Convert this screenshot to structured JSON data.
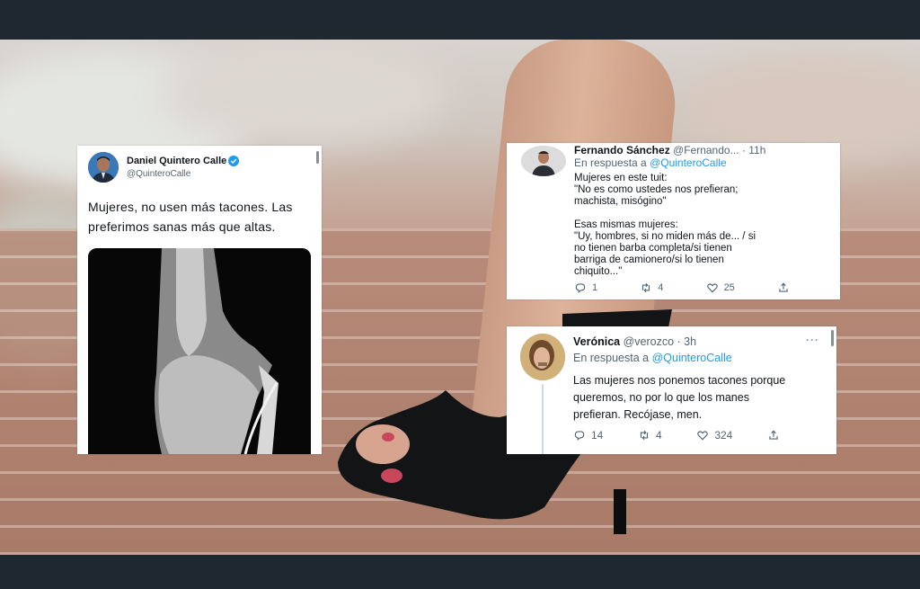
{
  "tweet_main": {
    "name": "Daniel Quintero Calle",
    "handle": "@QuinteroCalle",
    "text": "Mujeres, no usen más tacones. Las\npreferimos sanas más que altas."
  },
  "tweet_fernando": {
    "name": "Fernando Sánchez",
    "handle_time": "@Fernando... · 11h",
    "reply_prefix": "En respuesta a",
    "reply_to": "@QuinteroCalle",
    "text": "Mujeres en este tuit:\n\"No es como ustedes nos prefieran;\nmachista, misógino\"\n\nEsas mismas mujeres:\n\"Uy, hombres, si no miden más de... / si\nno tienen barba completa/si tienen\nbarriga de camionero/si lo tienen\nchiquito...\"",
    "replies": "1",
    "retweets": "4",
    "likes": "25"
  },
  "tweet_veronica": {
    "name": "Verónica",
    "handle_time": "@verozco · 3h",
    "reply_prefix": "En respuesta a",
    "reply_to": "@QuinteroCalle",
    "text": "Las mujeres nos ponemos tacones porque\nqueremos, no por lo que los manes\nprefieran. Recójase, men.",
    "replies": "14",
    "retweets": "4",
    "likes": "324"
  },
  "icons": {
    "verified": "verified-badge-icon",
    "reply": "reply-icon",
    "retweet": "retweet-icon",
    "like": "heart-icon",
    "share": "share-icon",
    "more": "more-icon"
  },
  "colors": {
    "accent": "#1d9bf0",
    "text": "#0f1419",
    "muted": "#536471",
    "frame": "#1f2730"
  }
}
